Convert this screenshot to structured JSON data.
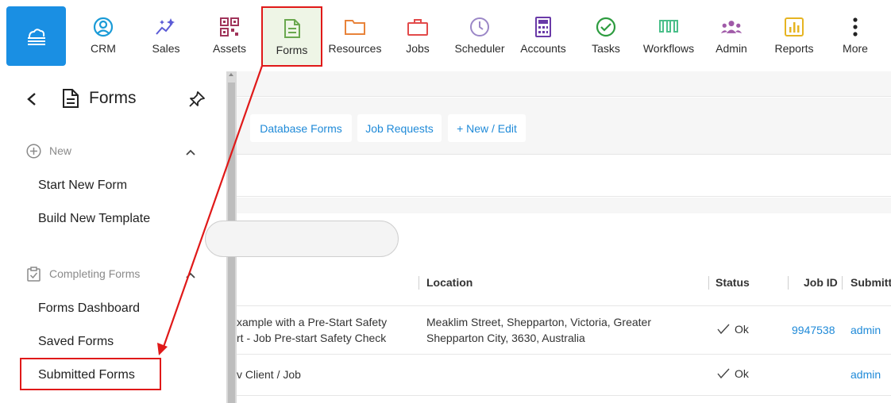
{
  "nav": {
    "items": [
      {
        "label": "CRM",
        "icon": "user-circle-icon",
        "color": "#1a9bd7"
      },
      {
        "label": "Sales",
        "icon": "sparkle-chart-icon",
        "color": "#5b5bd6"
      },
      {
        "label": "Assets",
        "icon": "qr-code-icon",
        "color": "#a0345a"
      },
      {
        "label": "Forms",
        "icon": "document-icon",
        "color": "#6aa84f"
      },
      {
        "label": "Resources",
        "icon": "folder-icon",
        "color": "#e8833a"
      },
      {
        "label": "Jobs",
        "icon": "briefcase-icon",
        "color": "#e24a4a"
      },
      {
        "label": "Scheduler",
        "icon": "clock-icon",
        "color": "#9b87c7"
      },
      {
        "label": "Accounts",
        "icon": "calculator-icon",
        "color": "#6a3aa8"
      },
      {
        "label": "Tasks",
        "icon": "check-circle-icon",
        "color": "#2d9c3f"
      },
      {
        "label": "Workflows",
        "icon": "workflow-icon",
        "color": "#4bbf8a"
      },
      {
        "label": "Admin",
        "icon": "users-icon",
        "color": "#a05aa8"
      },
      {
        "label": "Reports",
        "icon": "bar-chart-icon",
        "color": "#e6b422"
      },
      {
        "label": "More",
        "icon": "vertical-dots-icon",
        "color": "#222222"
      }
    ],
    "active": "Forms"
  },
  "panel": {
    "title": "Forms",
    "sections": [
      {
        "title": "New",
        "items": [
          "Start New Form",
          "Build New Template"
        ]
      },
      {
        "title": "Completing Forms",
        "items": [
          "Forms Dashboard",
          "Saved Forms",
          "Submitted Forms"
        ]
      }
    ]
  },
  "tabs": [
    "Database Forms",
    "Job Requests",
    "+ New / Edit"
  ],
  "table": {
    "headers": [
      "Location",
      "Status",
      "Job ID",
      "Submitte"
    ],
    "rows": [
      {
        "name_line1": "xample with a Pre-Start Safety",
        "name_line2": "rt - Job Pre-start Safety Check",
        "location_line1": "Meaklim Street, Shepparton, Victoria, Greater",
        "location_line2": "Shepparton City, 3630, Australia",
        "status": "Ok",
        "job_id": "9947538",
        "submitted_by": "admin"
      },
      {
        "name_line1": "v Client / Job",
        "location_line1": "",
        "status": "Ok",
        "job_id": "",
        "submitted_by": "admin"
      }
    ]
  },
  "colors": {
    "brand": "#1a8fe3",
    "link": "#1f8ad8",
    "highlight": "#e01919"
  }
}
